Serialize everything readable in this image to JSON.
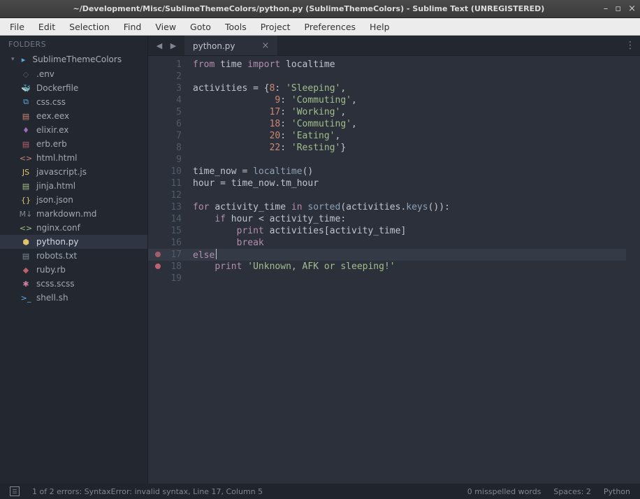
{
  "window": {
    "title": "~/Development/Misc/SublimeThemeColors/python.py (SublimeThemeColors) - Sublime Text (UNREGISTERED)"
  },
  "menu": [
    "File",
    "Edit",
    "Selection",
    "Find",
    "View",
    "Goto",
    "Tools",
    "Project",
    "Preferences",
    "Help"
  ],
  "sidebar": {
    "header": "FOLDERS",
    "folder": "SublimeThemeColors",
    "files": [
      {
        "name": ".env",
        "icon": "◇",
        "cls": "ic-env"
      },
      {
        "name": "Dockerfile",
        "icon": "🐳",
        "cls": "ic-docker"
      },
      {
        "name": "css.css",
        "icon": "⧉",
        "cls": "ic-css"
      },
      {
        "name": "eex.eex",
        "icon": "▤",
        "cls": "ic-eex"
      },
      {
        "name": "elixir.ex",
        "icon": "♦",
        "cls": "ic-elixir"
      },
      {
        "name": "erb.erb",
        "icon": "▤",
        "cls": "ic-erb"
      },
      {
        "name": "html.html",
        "icon": "<>",
        "cls": "ic-html"
      },
      {
        "name": "javascript.js",
        "icon": "JS",
        "cls": "ic-js"
      },
      {
        "name": "jinja.html",
        "icon": "▤",
        "cls": "ic-jinja"
      },
      {
        "name": "json.json",
        "icon": "{}",
        "cls": "ic-json"
      },
      {
        "name": "markdown.md",
        "icon": "M↓",
        "cls": "ic-md"
      },
      {
        "name": "nginx.conf",
        "icon": "<>",
        "cls": "ic-nginx"
      },
      {
        "name": "python.py",
        "icon": "⬢",
        "cls": "ic-python",
        "active": true
      },
      {
        "name": "robots.txt",
        "icon": "▤",
        "cls": "ic-robots"
      },
      {
        "name": "ruby.rb",
        "icon": "◆",
        "cls": "ic-ruby"
      },
      {
        "name": "scss.scss",
        "icon": "✱",
        "cls": "ic-scss"
      },
      {
        "name": "shell.sh",
        "icon": ">_",
        "cls": "ic-shell"
      }
    ]
  },
  "tabs": [
    {
      "label": "python.py",
      "active": true
    }
  ],
  "editor": {
    "currentLine": 17,
    "lines": [
      {
        "n": 1,
        "tokens": [
          [
            "kw",
            "from"
          ],
          [
            "",
            " "
          ],
          [
            "ident",
            "time"
          ],
          [
            "",
            " "
          ],
          [
            "kw",
            "import"
          ],
          [
            "",
            " "
          ],
          [
            "ident",
            "localtime"
          ]
        ]
      },
      {
        "n": 2,
        "tokens": []
      },
      {
        "n": 3,
        "tokens": [
          [
            "ident",
            "activities"
          ],
          [
            "",
            " "
          ],
          [
            "op",
            "="
          ],
          [
            "",
            " "
          ],
          [
            "punc",
            "{"
          ],
          [
            "num",
            "8"
          ],
          [
            "punc",
            ":"
          ],
          [
            "",
            " "
          ],
          [
            "str",
            "'Sleeping'"
          ],
          [
            "punc",
            ","
          ]
        ]
      },
      {
        "n": 4,
        "tokens": [
          [
            "",
            "               "
          ],
          [
            "num",
            "9"
          ],
          [
            "punc",
            ":"
          ],
          [
            "",
            " "
          ],
          [
            "str",
            "'Commuting'"
          ],
          [
            "punc",
            ","
          ]
        ]
      },
      {
        "n": 5,
        "tokens": [
          [
            "",
            "              "
          ],
          [
            "num",
            "17"
          ],
          [
            "punc",
            ":"
          ],
          [
            "",
            " "
          ],
          [
            "str",
            "'Working'"
          ],
          [
            "punc",
            ","
          ]
        ]
      },
      {
        "n": 6,
        "tokens": [
          [
            "",
            "              "
          ],
          [
            "num",
            "18"
          ],
          [
            "punc",
            ":"
          ],
          [
            "",
            " "
          ],
          [
            "str",
            "'Commuting'"
          ],
          [
            "punc",
            ","
          ]
        ]
      },
      {
        "n": 7,
        "tokens": [
          [
            "",
            "              "
          ],
          [
            "num",
            "20"
          ],
          [
            "punc",
            ":"
          ],
          [
            "",
            " "
          ],
          [
            "str",
            "'Eating'"
          ],
          [
            "punc",
            ","
          ]
        ]
      },
      {
        "n": 8,
        "tokens": [
          [
            "",
            "              "
          ],
          [
            "num",
            "22"
          ],
          [
            "punc",
            ":"
          ],
          [
            "",
            " "
          ],
          [
            "str",
            "'Resting'"
          ],
          [
            "punc",
            "}"
          ]
        ]
      },
      {
        "n": 9,
        "tokens": []
      },
      {
        "n": 10,
        "tokens": [
          [
            "ident",
            "time_now"
          ],
          [
            "",
            " "
          ],
          [
            "op",
            "="
          ],
          [
            "",
            " "
          ],
          [
            "fn",
            "localtime"
          ],
          [
            "punc",
            "()"
          ]
        ]
      },
      {
        "n": 11,
        "tokens": [
          [
            "ident",
            "hour"
          ],
          [
            "",
            " "
          ],
          [
            "op",
            "="
          ],
          [
            "",
            " "
          ],
          [
            "ident",
            "time_now"
          ],
          [
            "punc",
            "."
          ],
          [
            "ident",
            "tm_hour"
          ]
        ]
      },
      {
        "n": 12,
        "tokens": []
      },
      {
        "n": 13,
        "tokens": [
          [
            "kw",
            "for"
          ],
          [
            "",
            " "
          ],
          [
            "ident",
            "activity_time"
          ],
          [
            "",
            " "
          ],
          [
            "kw",
            "in"
          ],
          [
            "",
            " "
          ],
          [
            "builtin",
            "sorted"
          ],
          [
            "punc",
            "("
          ],
          [
            "ident",
            "activities"
          ],
          [
            "punc",
            "."
          ],
          [
            "fn",
            "keys"
          ],
          [
            "punc",
            "()):"
          ]
        ]
      },
      {
        "n": 14,
        "tokens": [
          [
            "",
            "    "
          ],
          [
            "kw",
            "if"
          ],
          [
            "",
            " "
          ],
          [
            "ident",
            "hour"
          ],
          [
            "",
            " "
          ],
          [
            "op",
            "<"
          ],
          [
            "",
            " "
          ],
          [
            "ident",
            "activity_time"
          ],
          [
            "punc",
            ":"
          ]
        ]
      },
      {
        "n": 15,
        "tokens": [
          [
            "",
            "        "
          ],
          [
            "kw",
            "print"
          ],
          [
            "",
            " "
          ],
          [
            "ident",
            "activities"
          ],
          [
            "punc",
            "["
          ],
          [
            "ident",
            "activity_time"
          ],
          [
            "punc",
            "]"
          ]
        ]
      },
      {
        "n": 16,
        "tokens": [
          [
            "",
            "        "
          ],
          [
            "kw",
            "break"
          ]
        ]
      },
      {
        "n": 17,
        "err": true,
        "cursor": true,
        "tokens": [
          [
            "kw",
            "else"
          ]
        ]
      },
      {
        "n": 18,
        "err": true,
        "tokens": [
          [
            "",
            "    "
          ],
          [
            "kw",
            "print"
          ],
          [
            "",
            " "
          ],
          [
            "str",
            "'Unknown, AFK or sleeping!'"
          ]
        ]
      },
      {
        "n": 19,
        "tokens": []
      }
    ]
  },
  "status": {
    "errors": "1 of 2 errors: SyntaxError: invalid syntax, Line 17, Column 5",
    "misspelled": "0 misspelled words",
    "spaces": "Spaces: 2",
    "lang": "Python"
  }
}
